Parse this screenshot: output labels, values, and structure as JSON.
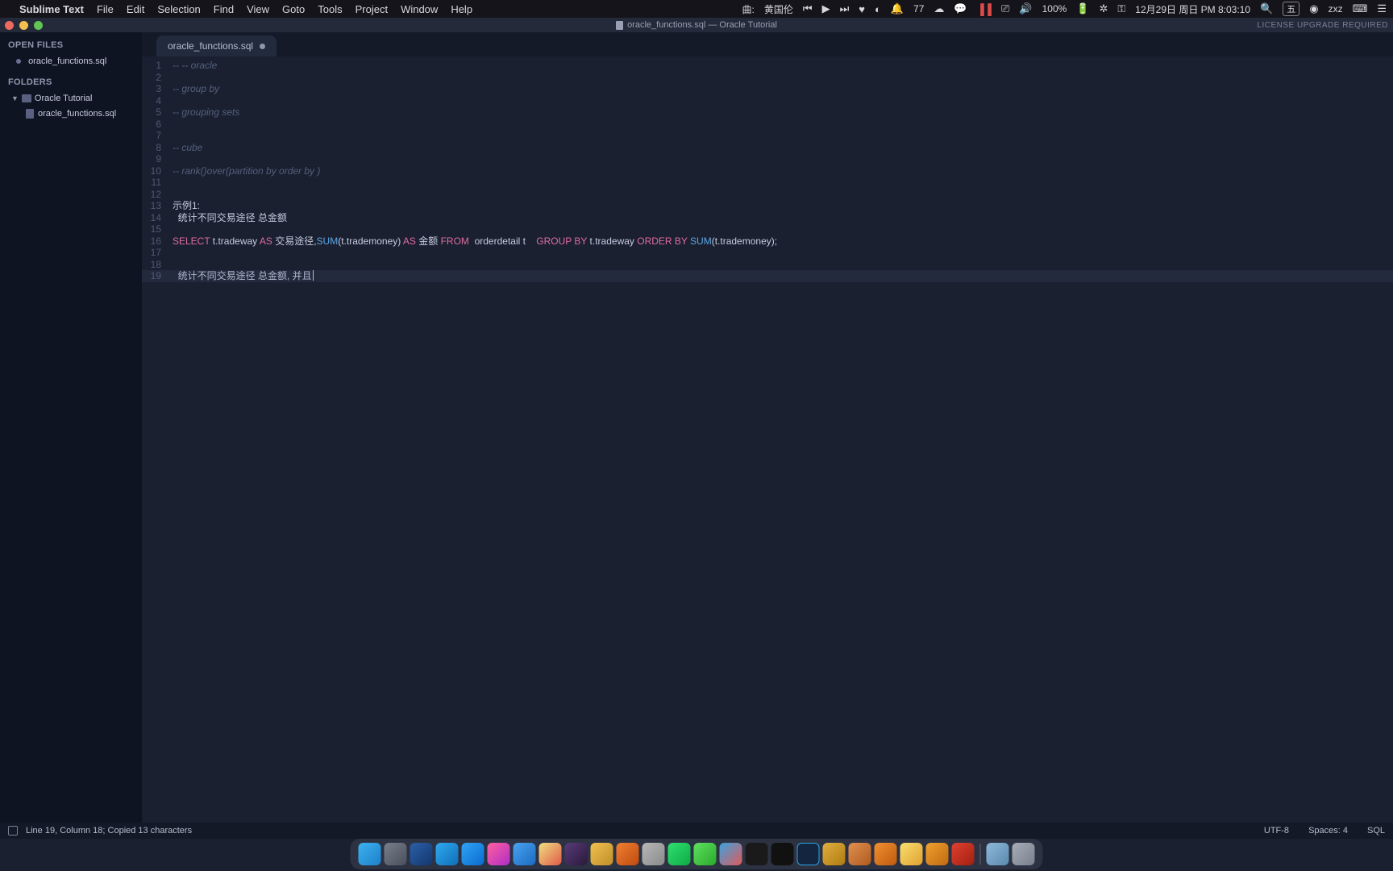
{
  "menubar": {
    "app_name": "Sublime Text",
    "items": [
      "File",
      "Edit",
      "Selection",
      "Find",
      "View",
      "Goto",
      "Tools",
      "Project",
      "Window",
      "Help"
    ],
    "now_playing_label": "曲:",
    "now_playing_value": "黄国伦",
    "input_method": "五",
    "notif_count": "77",
    "battery": "100%",
    "date_time": "12月29日 周日 PM 8:03:10",
    "user": "zxz"
  },
  "window": {
    "title": "oracle_functions.sql — Oracle Tutorial",
    "license_banner": "LICENSE UPGRADE REQUIRED"
  },
  "sidebar": {
    "open_files_heading": "OPEN FILES",
    "open_file": "oracle_functions.sql",
    "folders_heading": "FOLDERS",
    "root_folder": "Oracle Tutorial",
    "file": "oracle_functions.sql"
  },
  "tabs": [
    {
      "label": "oracle_functions.sql",
      "dirty": true
    }
  ],
  "code": {
    "line_numbers": [
      "1",
      "2",
      "3",
      "4",
      "5",
      "6",
      "7",
      "8",
      "9",
      "10",
      "11",
      "12",
      "13",
      "14",
      "15",
      "16",
      "17",
      "18",
      "19"
    ],
    "lines": {
      "l1": "-- -- oracle",
      "l3": "-- group by",
      "l5": "-- grouping sets",
      "l8": "-- cube",
      "l10": "-- rank()over(partition by order by )",
      "l13": "示例1:",
      "l14": "  统计不同交易途径 总金额",
      "l16_select": "SELECT",
      "l16_col1": " t.tradeway ",
      "l16_as1": "AS",
      "l16_col1alias": " 交易途径,",
      "l16_sum": "SUM",
      "l16_sumarg": "(t.trademoney) ",
      "l16_as2": "AS",
      "l16_col2alias": " 金额 ",
      "l16_from": "FROM",
      "l16_table": "  orderdetail t    ",
      "l16_groupby": "GROUP BY",
      "l16_gbcol": " t.tradeway ",
      "l16_orderby": "ORDER BY",
      "l16_sum2": " SUM",
      "l16_obarg": "(t.trademoney);",
      "l19": "  统计不同交易途径 总金额, 并且"
    },
    "current_line_index": 18
  },
  "status": {
    "left": "Line 19, Column 18; Copied 13 characters",
    "encoding": "UTF-8",
    "indent": "Spaces: 4",
    "syntax": "SQL"
  },
  "dock_items": [
    "finder",
    "settings",
    "globe",
    "safari",
    "appstore",
    "itunes",
    "zoom",
    "chrome",
    "fcpx",
    "pencil",
    "books",
    "pdf",
    "spotify",
    "wechat",
    "wecom",
    "term",
    "iterm",
    "ps",
    "nav",
    "plsql",
    "sublime",
    "face",
    "orange",
    "red"
  ]
}
